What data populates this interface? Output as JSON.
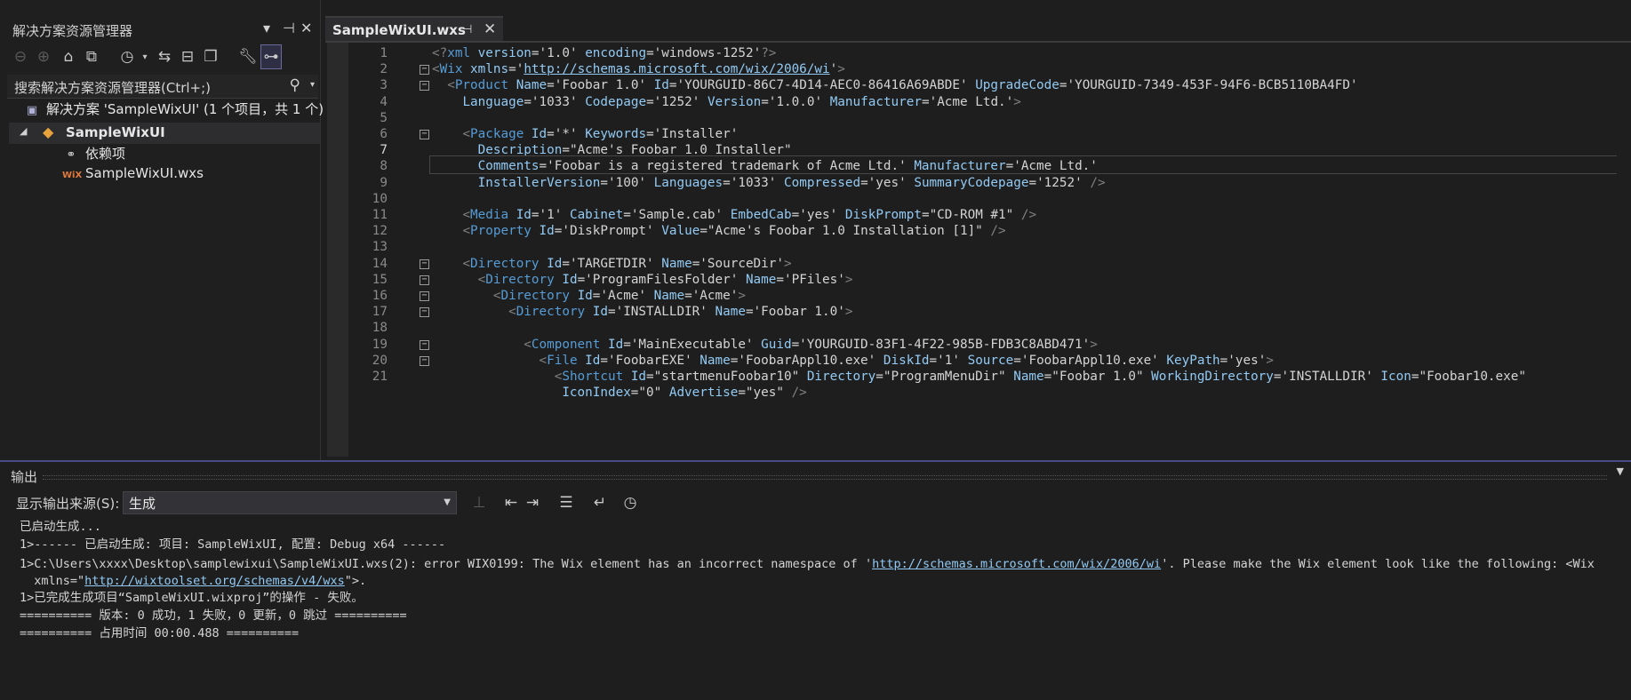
{
  "solution_explorer": {
    "title": "解决方案资源管理器",
    "search_label": "搜索解决方案资源管理器(Ctrl+;)",
    "solution_node": "解决方案 'SampleWixUI' (1 个项目，共 1 个)",
    "project_node": "SampleWixUI",
    "dependencies_node": "依赖项",
    "file_node": "SampleWixUI.wxs",
    "file_icon_text": "WiX"
  },
  "editor": {
    "tab_label": "SampleWixUI.wxs",
    "current_line": 7,
    "lines": [
      {
        "n": "1",
        "fold": "",
        "html": "<span class='t'>&lt;?</span><span class='e'>xml</span> <span class='a'>version</span><span class='v'>=</span><span class='v'>'1.0'</span> <span class='a'>encoding</span><span class='v'>=</span><span class='v'>'windows-1252'</span><span class='t'>?&gt;</span>"
      },
      {
        "n": "2",
        "fold": "−",
        "html": "<span class='t'>&lt;</span><span class='e'>Wix</span> <span class='a'>xmlns</span><span class='v'>=</span><span class='v'>'</span><span class='u'>http://schemas.microsoft.com/wix/2006/wi</span><span class='v'>'</span><span class='t'>&gt;</span>"
      },
      {
        "n": "3",
        "fold": "−",
        "html": "  <span class='t'>&lt;</span><span class='e'>Product</span> <span class='a'>Name</span><span class='v'>='Foobar 1.0'</span> <span class='a'>Id</span><span class='v'>='YOURGUID-86C7-4D14-AEC0-86416A69ABDE'</span> <span class='a'>UpgradeCode</span><span class='v'>='YOURGUID-7349-453F-94F6-BCB5110BA4FD'</span>"
      },
      {
        "n": "4",
        "fold": "",
        "html": "    <span class='a'>Language</span><span class='v'>='1033'</span> <span class='a'>Codepage</span><span class='v'>='1252'</span> <span class='a'>Version</span><span class='v'>='1.0.0'</span> <span class='a'>Manufacturer</span><span class='v'>='Acme Ltd.'</span><span class='t'>&gt;</span>"
      },
      {
        "n": "5",
        "fold": "",
        "html": ""
      },
      {
        "n": "6",
        "fold": "−",
        "html": "    <span class='t'>&lt;</span><span class='e'>Package</span> <span class='a'>Id</span><span class='v'>='*'</span> <span class='a'>Keywords</span><span class='v'>='Installer'</span>"
      },
      {
        "n": "7",
        "fold": "",
        "html": "      <span class='a'>Description</span><span class='v'>=\"Acme's Foobar 1.0 Installer\"</span>"
      },
      {
        "n": "8",
        "fold": "",
        "html": "      <span class='a'>Comments</span><span class='v'>='Foobar is a registered trademark of Acme Ltd.'</span> <span class='a'>Manufacturer</span><span class='v'>='Acme Ltd.'</span>"
      },
      {
        "n": "9",
        "fold": "",
        "html": "      <span class='a'>InstallerVersion</span><span class='v'>='100'</span> <span class='a'>Languages</span><span class='v'>='1033'</span> <span class='a'>Compressed</span><span class='v'>='yes'</span> <span class='a'>SummaryCodepage</span><span class='v'>='1252'</span> <span class='t'>/&gt;</span>"
      },
      {
        "n": "10",
        "fold": "",
        "html": ""
      },
      {
        "n": "11",
        "fold": "",
        "html": "    <span class='t'>&lt;</span><span class='e'>Media</span> <span class='a'>Id</span><span class='v'>='1'</span> <span class='a'>Cabinet</span><span class='v'>='Sample.cab'</span> <span class='a'>EmbedCab</span><span class='v'>='yes'</span> <span class='a'>DiskPrompt</span><span class='v'>=\"CD-ROM #1\"</span> <span class='t'>/&gt;</span>"
      },
      {
        "n": "12",
        "fold": "",
        "html": "    <span class='t'>&lt;</span><span class='e'>Property</span> <span class='a'>Id</span><span class='v'>='DiskPrompt'</span> <span class='a'>Value</span><span class='v'>=\"Acme's Foobar 1.0 Installation [1]\"</span> <span class='t'>/&gt;</span>"
      },
      {
        "n": "13",
        "fold": "",
        "html": ""
      },
      {
        "n": "14",
        "fold": "−",
        "html": "    <span class='t'>&lt;</span><span class='e'>Directory</span> <span class='a'>Id</span><span class='v'>='TARGETDIR'</span> <span class='a'>Name</span><span class='v'>='SourceDir'</span><span class='t'>&gt;</span>"
      },
      {
        "n": "15",
        "fold": "−",
        "html": "      <span class='t'>&lt;</span><span class='e'>Directory</span> <span class='a'>Id</span><span class='v'>='ProgramFilesFolder'</span> <span class='a'>Name</span><span class='v'>='PFiles'</span><span class='t'>&gt;</span>"
      },
      {
        "n": "16",
        "fold": "−",
        "html": "        <span class='t'>&lt;</span><span class='e'>Directory</span> <span class='a'>Id</span><span class='v'>='Acme'</span> <span class='a'>Name</span><span class='v'>='Acme'</span><span class='t'>&gt;</span>"
      },
      {
        "n": "17",
        "fold": "−",
        "html": "          <span class='t'>&lt;</span><span class='e'>Directory</span> <span class='a'>Id</span><span class='v'>='INSTALLDIR'</span> <span class='a'>Name</span><span class='v'>='Foobar 1.0'</span><span class='t'>&gt;</span>"
      },
      {
        "n": "18",
        "fold": "",
        "html": ""
      },
      {
        "n": "19",
        "fold": "−",
        "html": "            <span class='t'>&lt;</span><span class='e'>Component</span> <span class='a'>Id</span><span class='v'>='MainExecutable'</span> <span class='a'>Guid</span><span class='v'>='YOURGUID-83F1-4F22-985B-FDB3C8ABD471'</span><span class='t'>&gt;</span>"
      },
      {
        "n": "20",
        "fold": "−",
        "html": "              <span class='t'>&lt;</span><span class='e'>File</span> <span class='a'>Id</span><span class='v'>='FoobarEXE'</span> <span class='a'>Name</span><span class='v'>='FoobarAppl10.exe'</span> <span class='a'>DiskId</span><span class='v'>='1'</span> <span class='a'>Source</span><span class='v'>='FoobarAppl10.exe'</span> <span class='a'>KeyPath</span><span class='v'>='yes'</span><span class='t'>&gt;</span>"
      },
      {
        "n": "21",
        "fold": "",
        "html": "                <span class='t'>&lt;</span><span class='e'>Shortcut</span> <span class='a'>Id</span><span class='v'>=\"startmenuFoobar10\"</span> <span class='a'>Directory</span><span class='v'>=\"ProgramMenuDir\"</span> <span class='a'>Name</span><span class='v'>=\"Foobar 1.0\"</span> <span class='a'>WorkingDirectory</span><span class='v'>='INSTALLDIR'</span> <span class='a'>Icon</span><span class='v'>=\"Foobar10.exe\"</span>"
      },
      {
        "n": "",
        "fold": "",
        "html": "                 <span class='a'>IconIndex</span><span class='v'>=\"0\"</span> <span class='a'>Advertise</span><span class='v'>=\"yes\"</span> <span class='t'>/&gt;</span>"
      }
    ]
  },
  "output": {
    "title": "输出",
    "source_label": "显示输出来源(S):",
    "source_value": "生成",
    "lines": [
      "已启动生成...",
      "1>------ 已启动生成: 项目: SampleWixUI, 配置: Debug x64 ------",
      "1>C:\\Users\\xxxx\\Desktop\\samplewixui\\SampleWixUI.wxs(2): error WIX0199: The Wix element has an incorrect namespace of '",
      "  xmlns=\"",
      "1>已完成生成项目“SampleWixUI.wixproj”的操作 - 失败。",
      "========== 版本: 0 成功，1 失败，0 更新，0 跳过 ==========",
      "========== 占用时间 00:00.488 =========="
    ],
    "error_link": "http://schemas.microsoft.com/wix/2006/wi",
    "error_tail": "'. Please make the Wix element look like the following: <Wix",
    "fix_link": "http://wixtoolset.org/schemas/v4/wxs",
    "fix_tail": "\">."
  }
}
